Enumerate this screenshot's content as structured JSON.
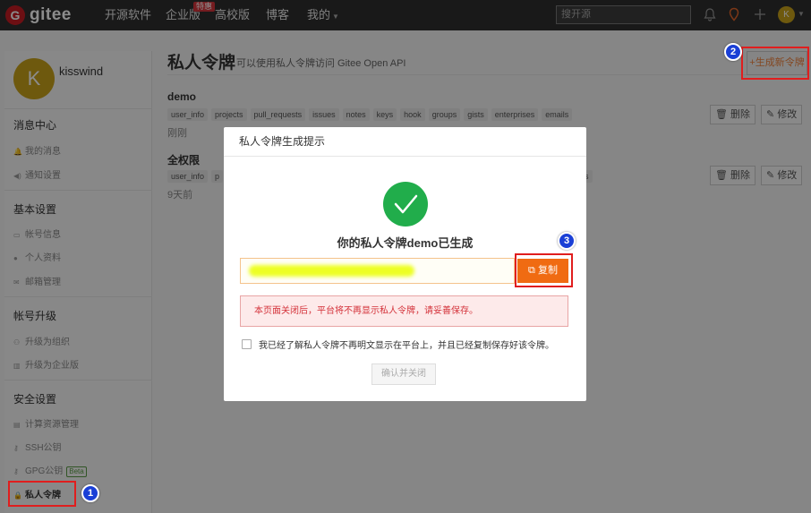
{
  "header": {
    "logo_mark": "G",
    "logo_text": "gitee",
    "nav": [
      "开源软件",
      "企业版",
      "高校版",
      "博客",
      "我的"
    ],
    "enterprise_badge": "特惠",
    "search_placeholder": "搜开源",
    "avatar_letter": "K"
  },
  "sidebar": {
    "avatar_letter": "K",
    "username": "kisswind",
    "sections": [
      {
        "title": "消息中心",
        "items": [
          "我的消息",
          "通知设置"
        ]
      },
      {
        "title": "基本设置",
        "items": [
          "帐号信息",
          "个人资料",
          "邮箱管理"
        ]
      },
      {
        "title": "帐号升级",
        "items": [
          "升级为组织",
          "升级为企业版"
        ]
      },
      {
        "title": "安全设置",
        "items": [
          "计算资源管理",
          "SSH公钥",
          "GPG公钥",
          "私人令牌"
        ]
      }
    ],
    "beta_label": "Beta"
  },
  "main": {
    "title": "私人令牌",
    "subtitle": "可以使用私人令牌访问 Gitee Open API",
    "generate_button": "+生成新令牌",
    "tokens": [
      {
        "name": "demo",
        "scopes": [
          "user_info",
          "projects",
          "pull_requests",
          "issues",
          "notes",
          "keys",
          "hook",
          "groups",
          "gists",
          "enterprises",
          "emails"
        ],
        "time": "刚刚"
      },
      {
        "name": "全权限",
        "scopes": [
          "user_info",
          "p",
          "ls"
        ],
        "time": "9天前"
      }
    ],
    "delete_label": "删除",
    "edit_label": "修改"
  },
  "modal": {
    "header": "私人令牌生成提示",
    "title": "你的私人令牌demo已生成",
    "copy_button": "复制",
    "warning": "本页面关闭后，平台将不再显示私人令牌，请妥善保存。",
    "acknowledge": "我已经了解私人令牌不再明文显示在平台上，并且已经复制保存好该令牌。",
    "confirm_button": "确认并关闭"
  },
  "annotations": [
    "1",
    "2",
    "3"
  ]
}
